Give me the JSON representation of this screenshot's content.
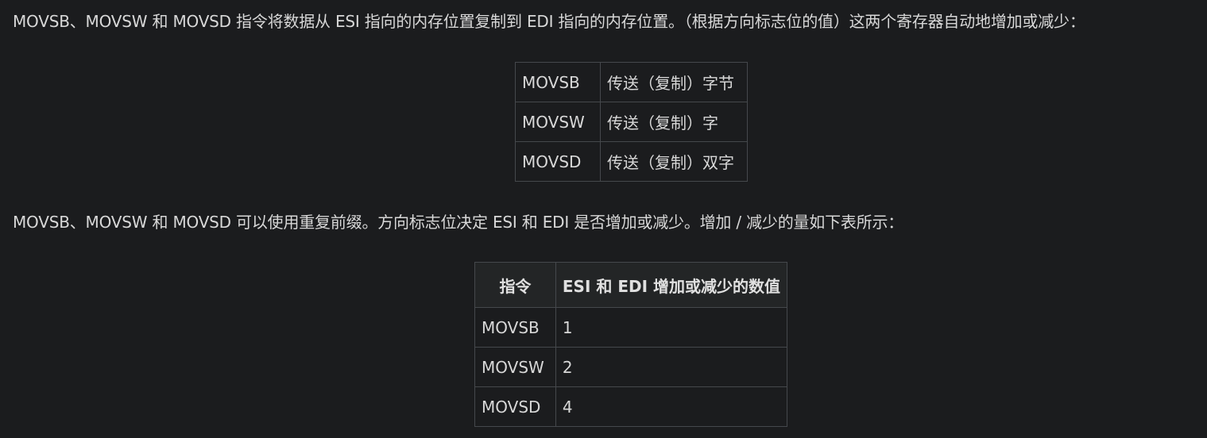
{
  "paragraph1": "MOVSB、MOVSW 和 MOVSD 指令将数据从 ESI 指向的内存位置复制到 EDI 指向的内存位置。（根据方向标志位的值）这两个寄存器自动地增加或减少：",
  "table1": {
    "rows": [
      {
        "instr": "MOVSB",
        "desc": "传送（复制）字节"
      },
      {
        "instr": "MOVSW",
        "desc": "传送（复制）字"
      },
      {
        "instr": "MOVSD",
        "desc": "传送（复制）双字"
      }
    ]
  },
  "paragraph2": "MOVSB、MOVSW 和 MOVSD 可以使用重复前缀。方向标志位决定 ESI 和 EDI 是否增加或减少。增加 / 减少的量如下表所示：",
  "table2": {
    "headers": [
      "指令",
      "ESI 和 EDI 增加或减少的数值"
    ],
    "rows": [
      {
        "instr": "MOVSB",
        "value": "1"
      },
      {
        "instr": "MOVSW",
        "value": "2"
      },
      {
        "instr": "MOVSD",
        "value": "4"
      }
    ]
  }
}
